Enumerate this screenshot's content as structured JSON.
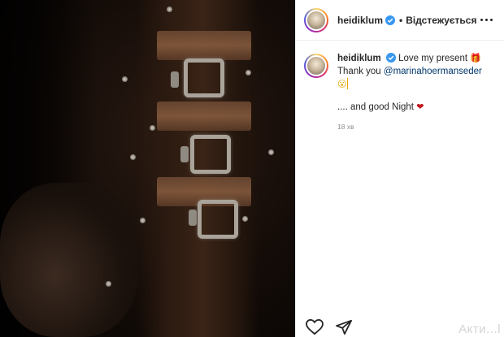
{
  "header": {
    "username": "heidiklum",
    "separator": "•",
    "follow_label": "Відстежується"
  },
  "caption": {
    "username": "heidiklum",
    "line1": "Love my present",
    "line2_prefix": "Thank you ",
    "mention": "@marinahoermanseder",
    "line3": ".... and good Night",
    "gift_emoji": "🎁",
    "face_emoji": "😮",
    "heart_emoji": "❤",
    "timestamp": "18 хв"
  },
  "icons": {
    "verified": "verified-badge-icon",
    "more": "more-options-icon",
    "like": "heart-outline-icon",
    "share": "paper-plane-icon"
  },
  "watermark": "Акти...l",
  "colors": {
    "verified": "#3897f0",
    "mention": "#00376b",
    "heart": "#c0151a",
    "timestamp": "#8e8e8e"
  }
}
